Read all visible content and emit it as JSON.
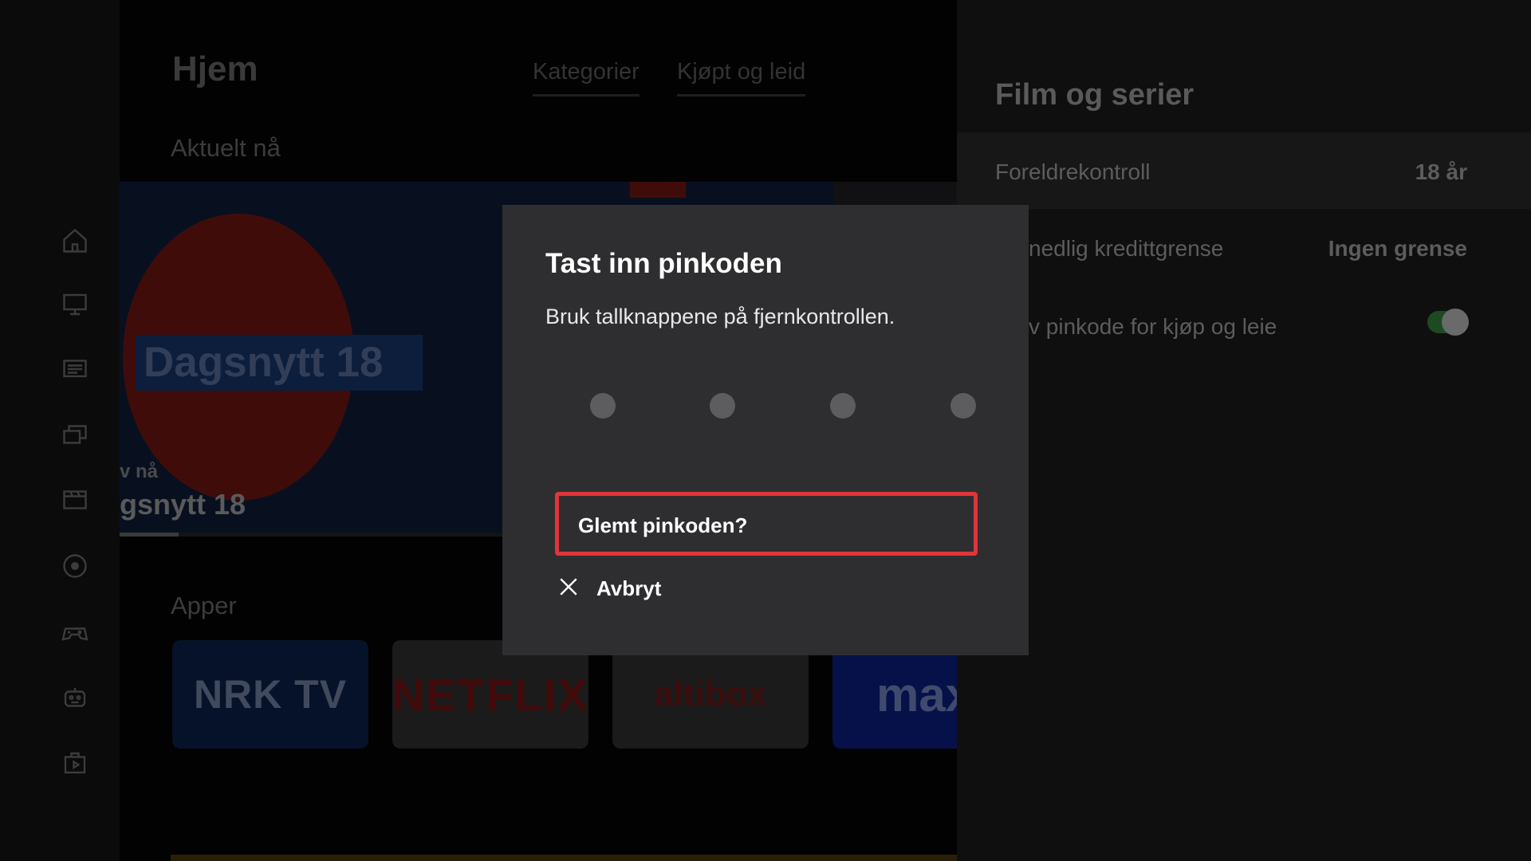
{
  "home": {
    "title": "Hjem",
    "tabs": [
      {
        "label": "Kategorier"
      },
      {
        "label": "Kjøpt og leid"
      }
    ],
    "sections": {
      "now": "Aktuelt nå",
      "apps": "Apper"
    },
    "hero": {
      "logo_text": "Dagsnytt 18",
      "subtitle": "v nå",
      "name": "gsnytt 18",
      "progress_fraction": 0.07
    },
    "apps": [
      {
        "label": "NRK TV"
      },
      {
        "label": "NETFLIX"
      },
      {
        "label": "altibox"
      },
      {
        "label": "max"
      }
    ]
  },
  "sidebar": {
    "icons": [
      "home-icon",
      "tv-icon",
      "guide-icon",
      "library-icon",
      "movies-icon",
      "record-icon",
      "games-icon",
      "kids-icon",
      "store-icon"
    ]
  },
  "panel": {
    "title": "Film og serier",
    "rows": [
      {
        "label": "Foreldrekontroll",
        "value": "18 år"
      },
      {
        "label": "nedlig kredittgrense",
        "value": "Ingen grense"
      },
      {
        "label": "v pinkode for kjøp og leie",
        "toggle": true
      }
    ]
  },
  "modal": {
    "title": "Tast inn pinkoden",
    "subtitle": "Bruk tallknappene på fjernkontrollen.",
    "pin_length": 4,
    "forgot_label": "Glemt pinkoden?",
    "cancel_label": "Avbryt"
  },
  "colors": {
    "focus_border": "#e0353a",
    "modal_bg": "#2e2e30",
    "toggle_on": "#1d4a22"
  }
}
